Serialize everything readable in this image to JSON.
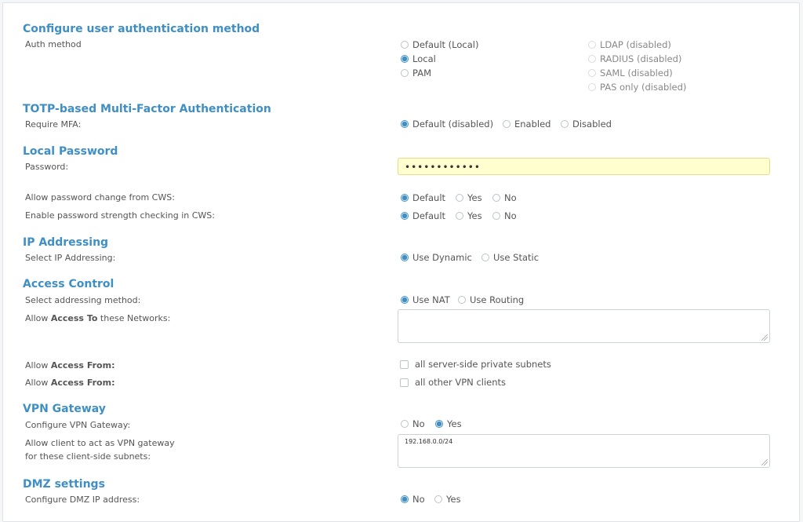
{
  "auth": {
    "title": "Configure user authentication method",
    "label": "Auth method",
    "col1": [
      "Default (Local)",
      "Local",
      "PAM"
    ],
    "col2": [
      "LDAP (disabled)",
      "RADIUS (disabled)",
      "SAML (disabled)",
      "PAS only (disabled)"
    ],
    "selected": "Local"
  },
  "mfa": {
    "title": "TOTP-based Multi-Factor Authentication",
    "label": "Require MFA:",
    "options": [
      "Default (disabled)",
      "Enabled",
      "Disabled"
    ],
    "selected": "Default (disabled)"
  },
  "password": {
    "title": "Local Password",
    "label": "Password:",
    "value": "••••••••••••",
    "change_label": "Allow password change from CWS:",
    "change_options": [
      "Default",
      "Yes",
      "No"
    ],
    "strength_label": "Enable password strength checking in CWS:",
    "strength_options": [
      "Default",
      "Yes",
      "No"
    ]
  },
  "ip": {
    "title": "IP Addressing",
    "label": "Select IP Addressing:",
    "options": [
      "Use Dynamic",
      "Use Static"
    ],
    "selected": "Use Dynamic"
  },
  "access": {
    "title": "Access Control",
    "method_label": "Select addressing method:",
    "method_options": [
      "Use NAT",
      "Use Routing"
    ],
    "selected": "Use NAT",
    "networks_label_pre": "Allow ",
    "networks_label_bold": "Access To",
    "networks_label_post": " these Networks:",
    "networks_value": "",
    "from1_pre": "Allow ",
    "from1_bold": "Access From:",
    "from1_option": "all server-side private subnets",
    "from2_pre": "Allow ",
    "from2_bold": "Access From:",
    "from2_option": "all other VPN clients"
  },
  "gateway": {
    "title": "VPN Gateway",
    "label": "Configure VPN Gateway:",
    "options": [
      "No",
      "Yes"
    ],
    "selected": "Yes",
    "subnets_label_1": "Allow client to act as VPN gateway",
    "subnets_label_2": "for these client-side subnets:",
    "subnets_value": "192.168.0.0/24"
  },
  "dmz": {
    "title": "DMZ settings",
    "label": "Configure DMZ IP address:",
    "options": [
      "No",
      "Yes"
    ],
    "selected": "No"
  }
}
